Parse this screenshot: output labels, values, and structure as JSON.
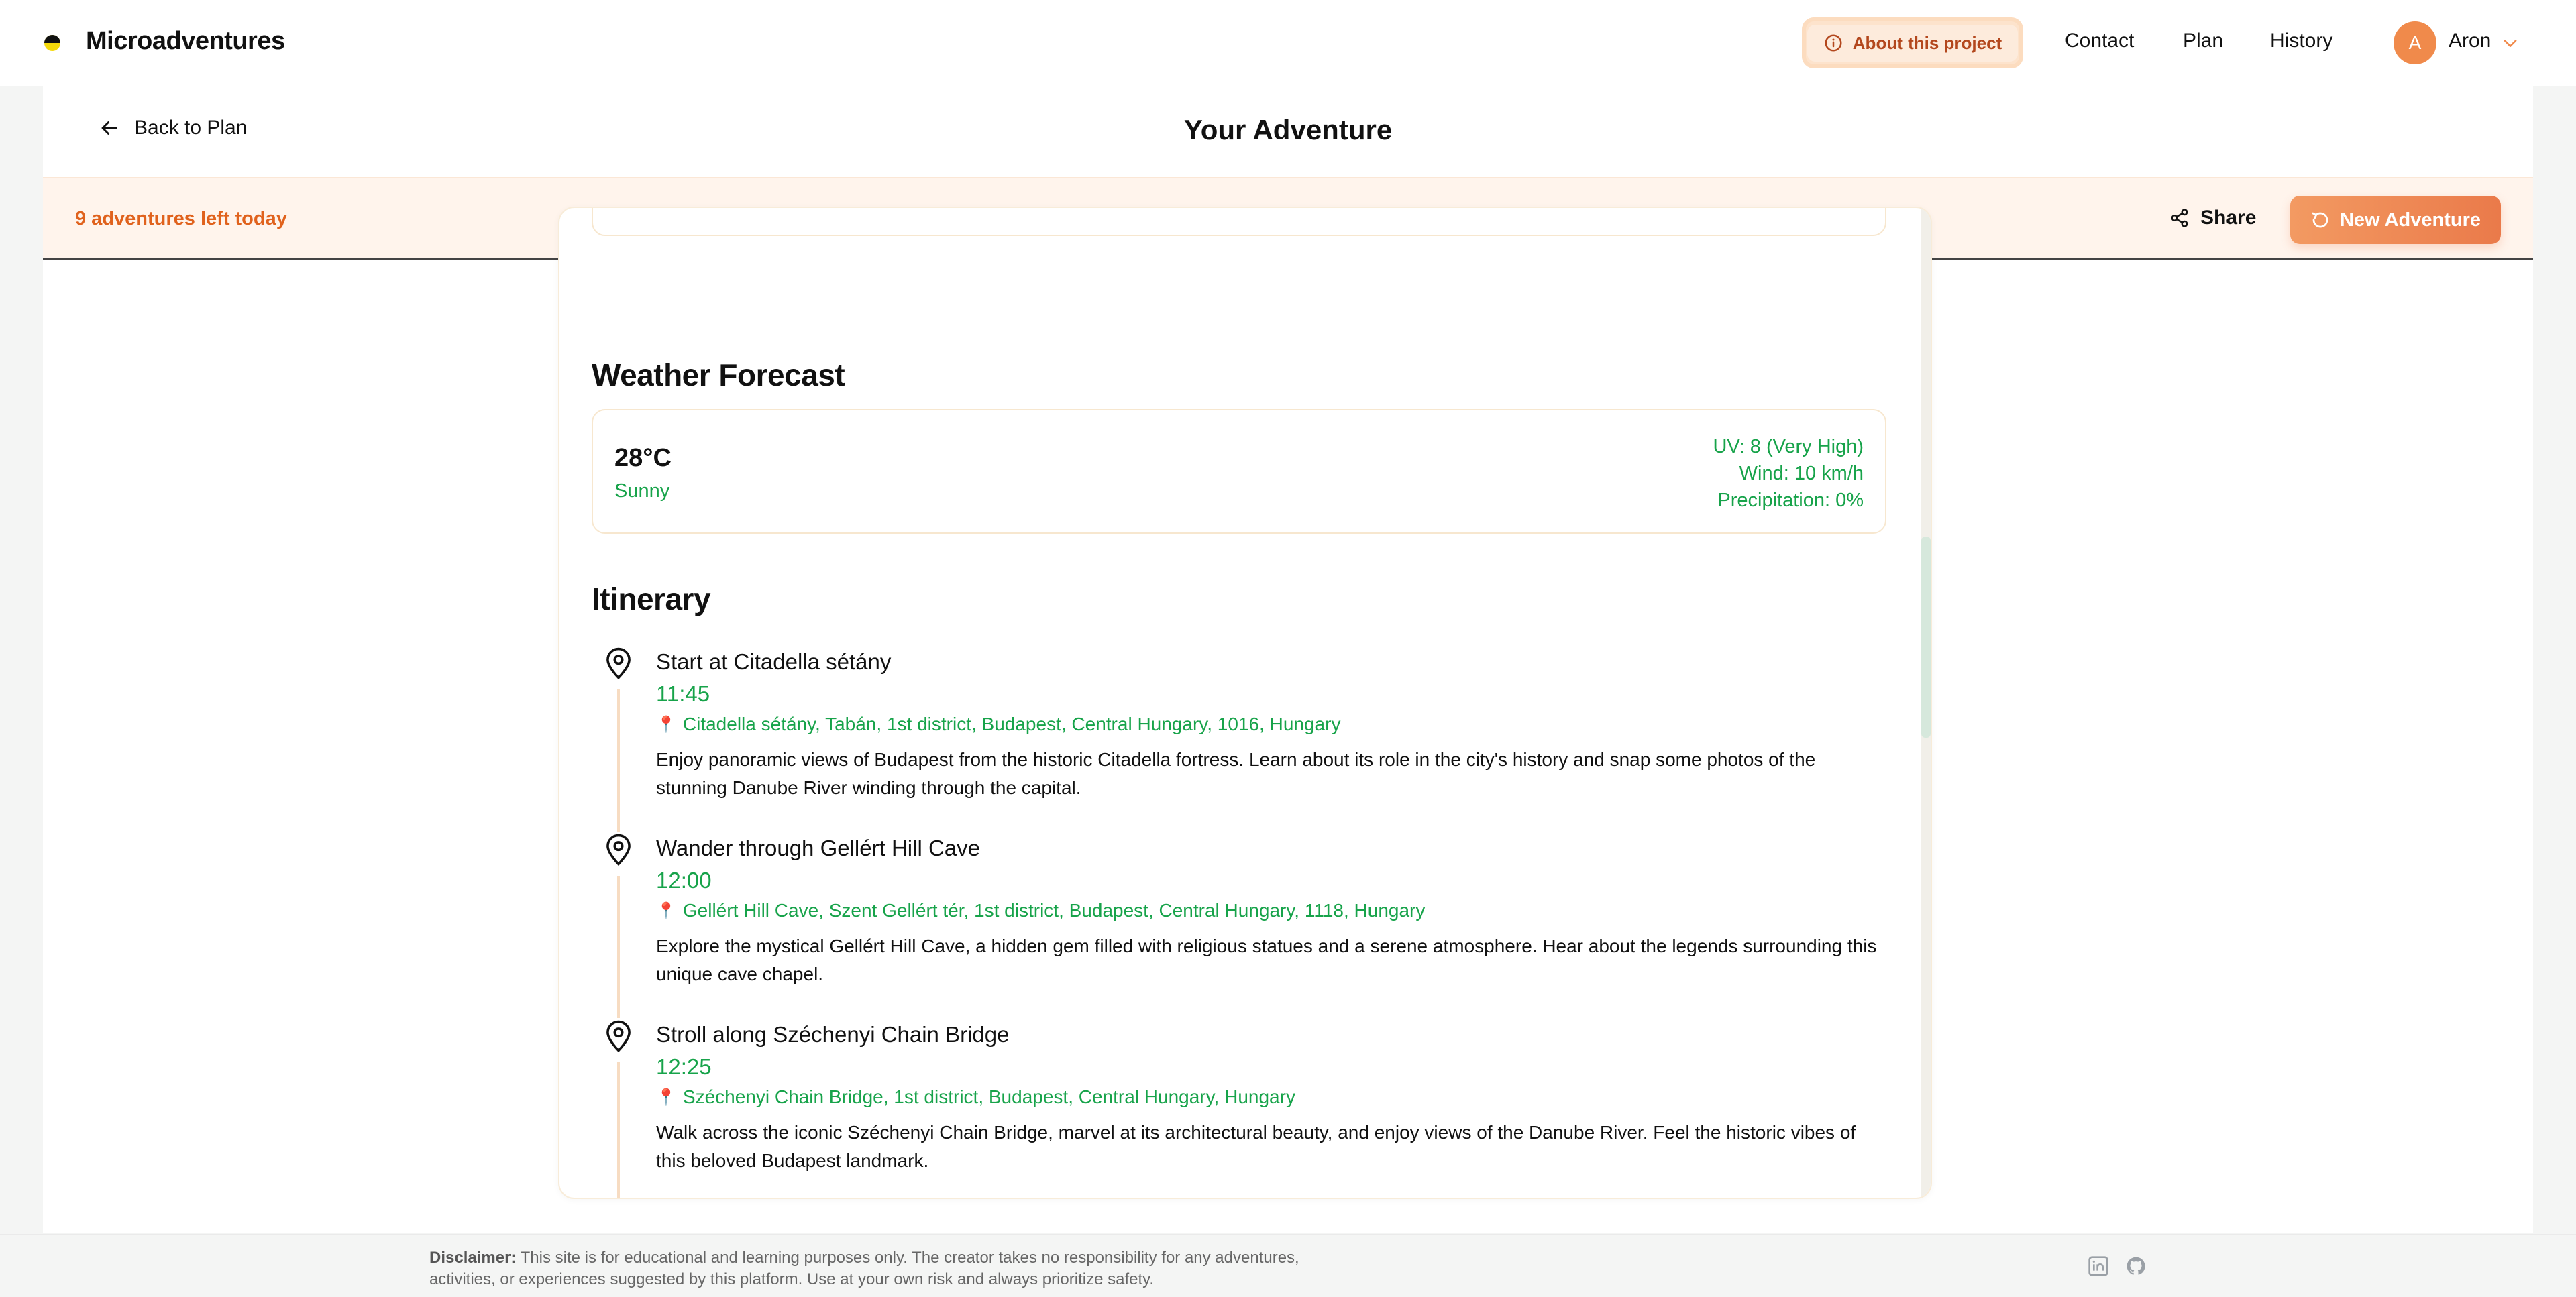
{
  "brand": {
    "name": "Microadventures",
    "logo_icon": "half-moon-logo",
    "logo_colors": [
      "#111111",
      "#f5d90a"
    ]
  },
  "nav": {
    "about_label": "About this project",
    "links": [
      "Contact",
      "Plan",
      "History"
    ],
    "user": {
      "initial": "A",
      "name": "Aron",
      "avatar_color": "#f08a4b"
    }
  },
  "page": {
    "back_label": "Back to Plan",
    "title": "Your Adventure"
  },
  "toolbar": {
    "quota_text": "9 adventures left today",
    "share_label": "Share",
    "new_adventure_label": "New Adventure",
    "accent": "#ea7a4a"
  },
  "weather": {
    "section_title": "Weather Forecast",
    "temperature": "28°C",
    "condition": "Sunny",
    "uv": "UV: 8 (Very High)",
    "wind": "Wind: 10 km/h",
    "precipitation": "Precipitation: 0%"
  },
  "itinerary": {
    "section_title": "Itinerary",
    "stops": [
      {
        "title": "Start at Citadella sétány",
        "time": "11:45",
        "address": "Citadella sétány, Tabán, 1st district, Budapest, Central Hungary, 1016, Hungary",
        "description": "Enjoy panoramic views of Budapest from the historic Citadella fortress. Learn about its role in the city's history and snap some photos of the stunning Danube River winding through the capital."
      },
      {
        "title": "Wander through Gellért Hill Cave",
        "time": "12:00",
        "address": "Gellért Hill Cave, Szent Gellért tér, 1st district, Budapest, Central Hungary, 1118, Hungary",
        "description": "Explore the mystical Gellért Hill Cave, a hidden gem filled with religious statues and a serene atmosphere. Hear about the legends surrounding this unique cave chapel."
      },
      {
        "title": "Stroll along Széchenyi Chain Bridge",
        "time": "12:25",
        "address": "Széchenyi Chain Bridge, 1st district, Budapest, Central Hungary, Hungary",
        "description": "Walk across the iconic Széchenyi Chain Bridge, marvel at its architectural beauty, and enjoy views of the Danube River. Feel the historic vibes of this beloved Budapest landmark."
      }
    ]
  },
  "footer": {
    "disclaimer_label": "Disclaimer:",
    "disclaimer_text": "This site is for educational and learning purposes only. The creator takes no responsibility for any adventures, activities, or experiences suggested by this platform. Use at your own risk and always prioritize safety.",
    "icons": [
      "linkedin-icon",
      "github-icon"
    ]
  },
  "colors": {
    "green": "#17a34a",
    "orange_text": "#e0621d",
    "about_text": "#b3471d"
  }
}
